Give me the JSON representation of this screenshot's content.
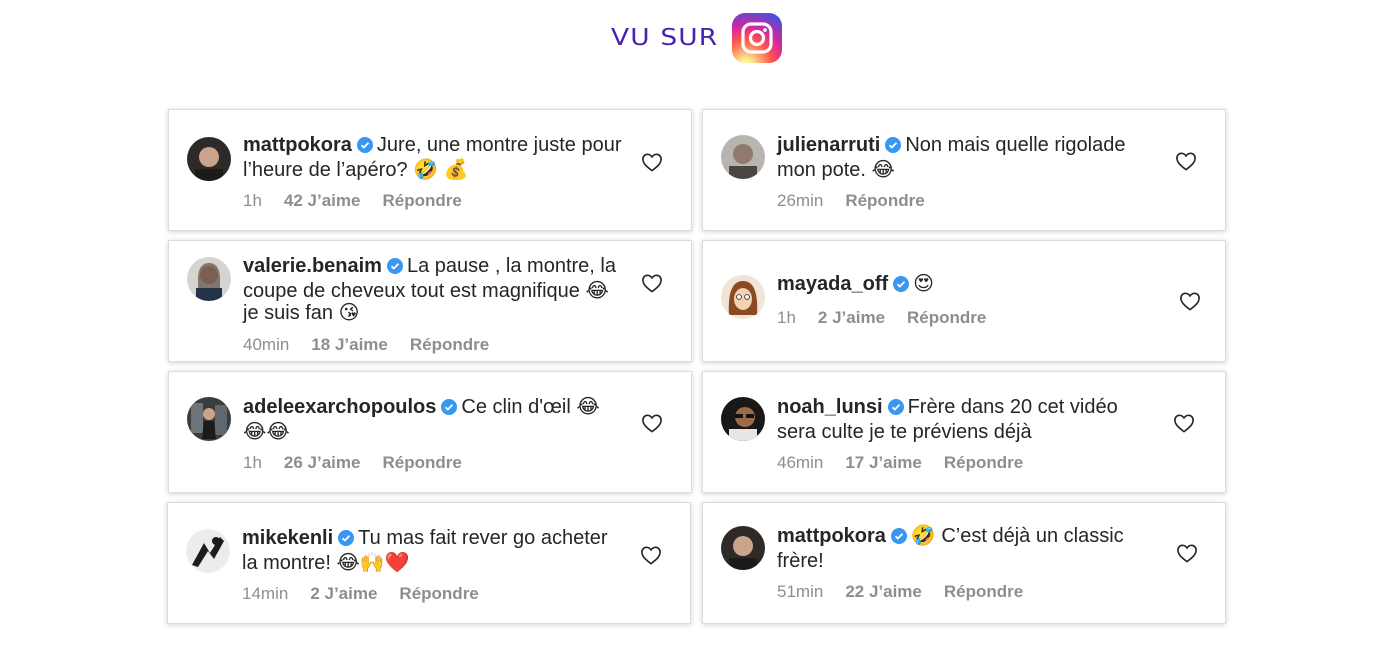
{
  "header": {
    "label": "VU SUR",
    "logo": "instagram-logo"
  },
  "colors": {
    "label": "#4b1fb0",
    "verified": "#3897f0",
    "meta": "#8e8e8e"
  },
  "comments": [
    {
      "username": "mattpokora",
      "text": "Jure, une montre juste pour l’heure de l’apéro? 🤣 💰",
      "time": "1h",
      "likes": "42 J’aime",
      "reply": "Répondre"
    },
    {
      "username": "julienarruti",
      "text": "Non mais quelle rigolade mon pote. 😂",
      "time": "26min",
      "likes": "",
      "reply": "Répondre"
    },
    {
      "username": "valerie.benaim",
      "text": "La pause , la montre, la coupe de cheveux tout est magnifique 😂 je suis fan 😘",
      "time": "40min",
      "likes": "18 J’aime",
      "reply": "Répondre"
    },
    {
      "username": "mayada_off",
      "text": "😍",
      "time": "1h",
      "likes": "2 J’aime",
      "reply": "Répondre"
    },
    {
      "username": "adeleexarchopoulos",
      "text": "Ce clin d'œil 😂 😂😂",
      "time": "1h",
      "likes": "26 J’aime",
      "reply": "Répondre"
    },
    {
      "username": "noah_lunsi",
      "text": "Frère dans 20 cet vidéo sera culte je te préviens déjà",
      "time": "46min",
      "likes": "17 J’aime",
      "reply": "Répondre"
    },
    {
      "username": "mikekenli",
      "text": "Tu mas fait rever go acheter la montre! 😂🙌❤️",
      "time": "14min",
      "likes": "2 J’aime",
      "reply": "Répondre"
    },
    {
      "username": "mattpokora",
      "text": "🤣 C’est déjà un classic frère!",
      "time": "51min",
      "likes": "22 J’aime",
      "reply": "Répondre"
    }
  ]
}
